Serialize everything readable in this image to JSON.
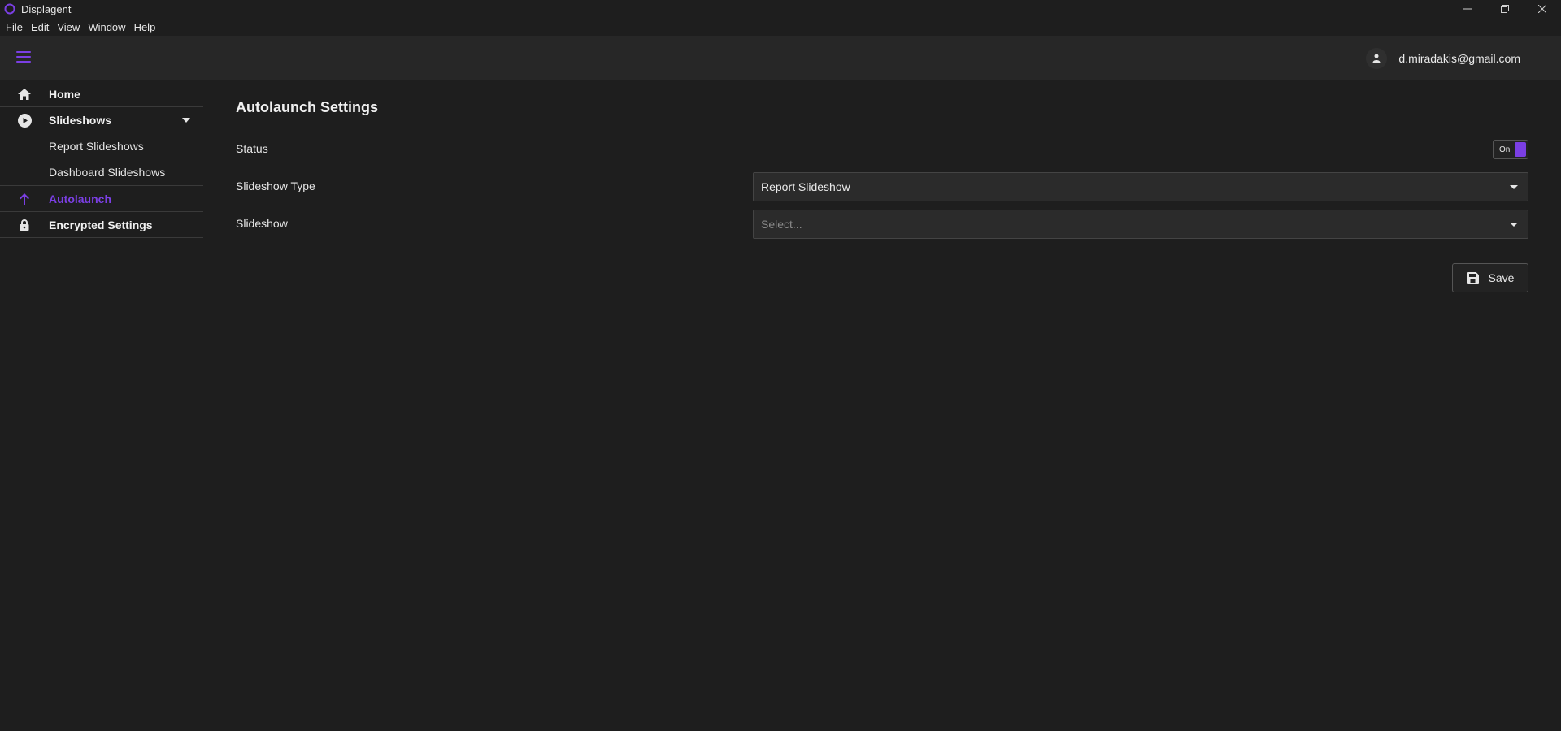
{
  "window": {
    "title": "Displagent"
  },
  "menubar": {
    "items": [
      "File",
      "Edit",
      "View",
      "Window",
      "Help"
    ]
  },
  "header": {
    "user_email": "d.miradakis@gmail.com",
    "menu_icon": "hamburger-icon",
    "user_icon": "user-icon"
  },
  "sidebar": {
    "home": "Home",
    "slideshows": "Slideshows",
    "report_slideshows": "Report Slideshows",
    "dashboard_slideshows": "Dashboard Slideshows",
    "autolaunch": "Autolaunch",
    "encrypted_settings": "Encrypted Settings"
  },
  "main": {
    "title": "Autolaunch Settings",
    "status_label": "Status",
    "status_toggle": "On",
    "slideshow_type_label": "Slideshow Type",
    "slideshow_type_value": "Report Slideshow",
    "slideshow_label": "Slideshow",
    "slideshow_placeholder": "Select...",
    "save_label": "Save"
  },
  "colors": {
    "accent": "#7b3fe4",
    "background": "#1e1e1e",
    "header": "#272727"
  }
}
